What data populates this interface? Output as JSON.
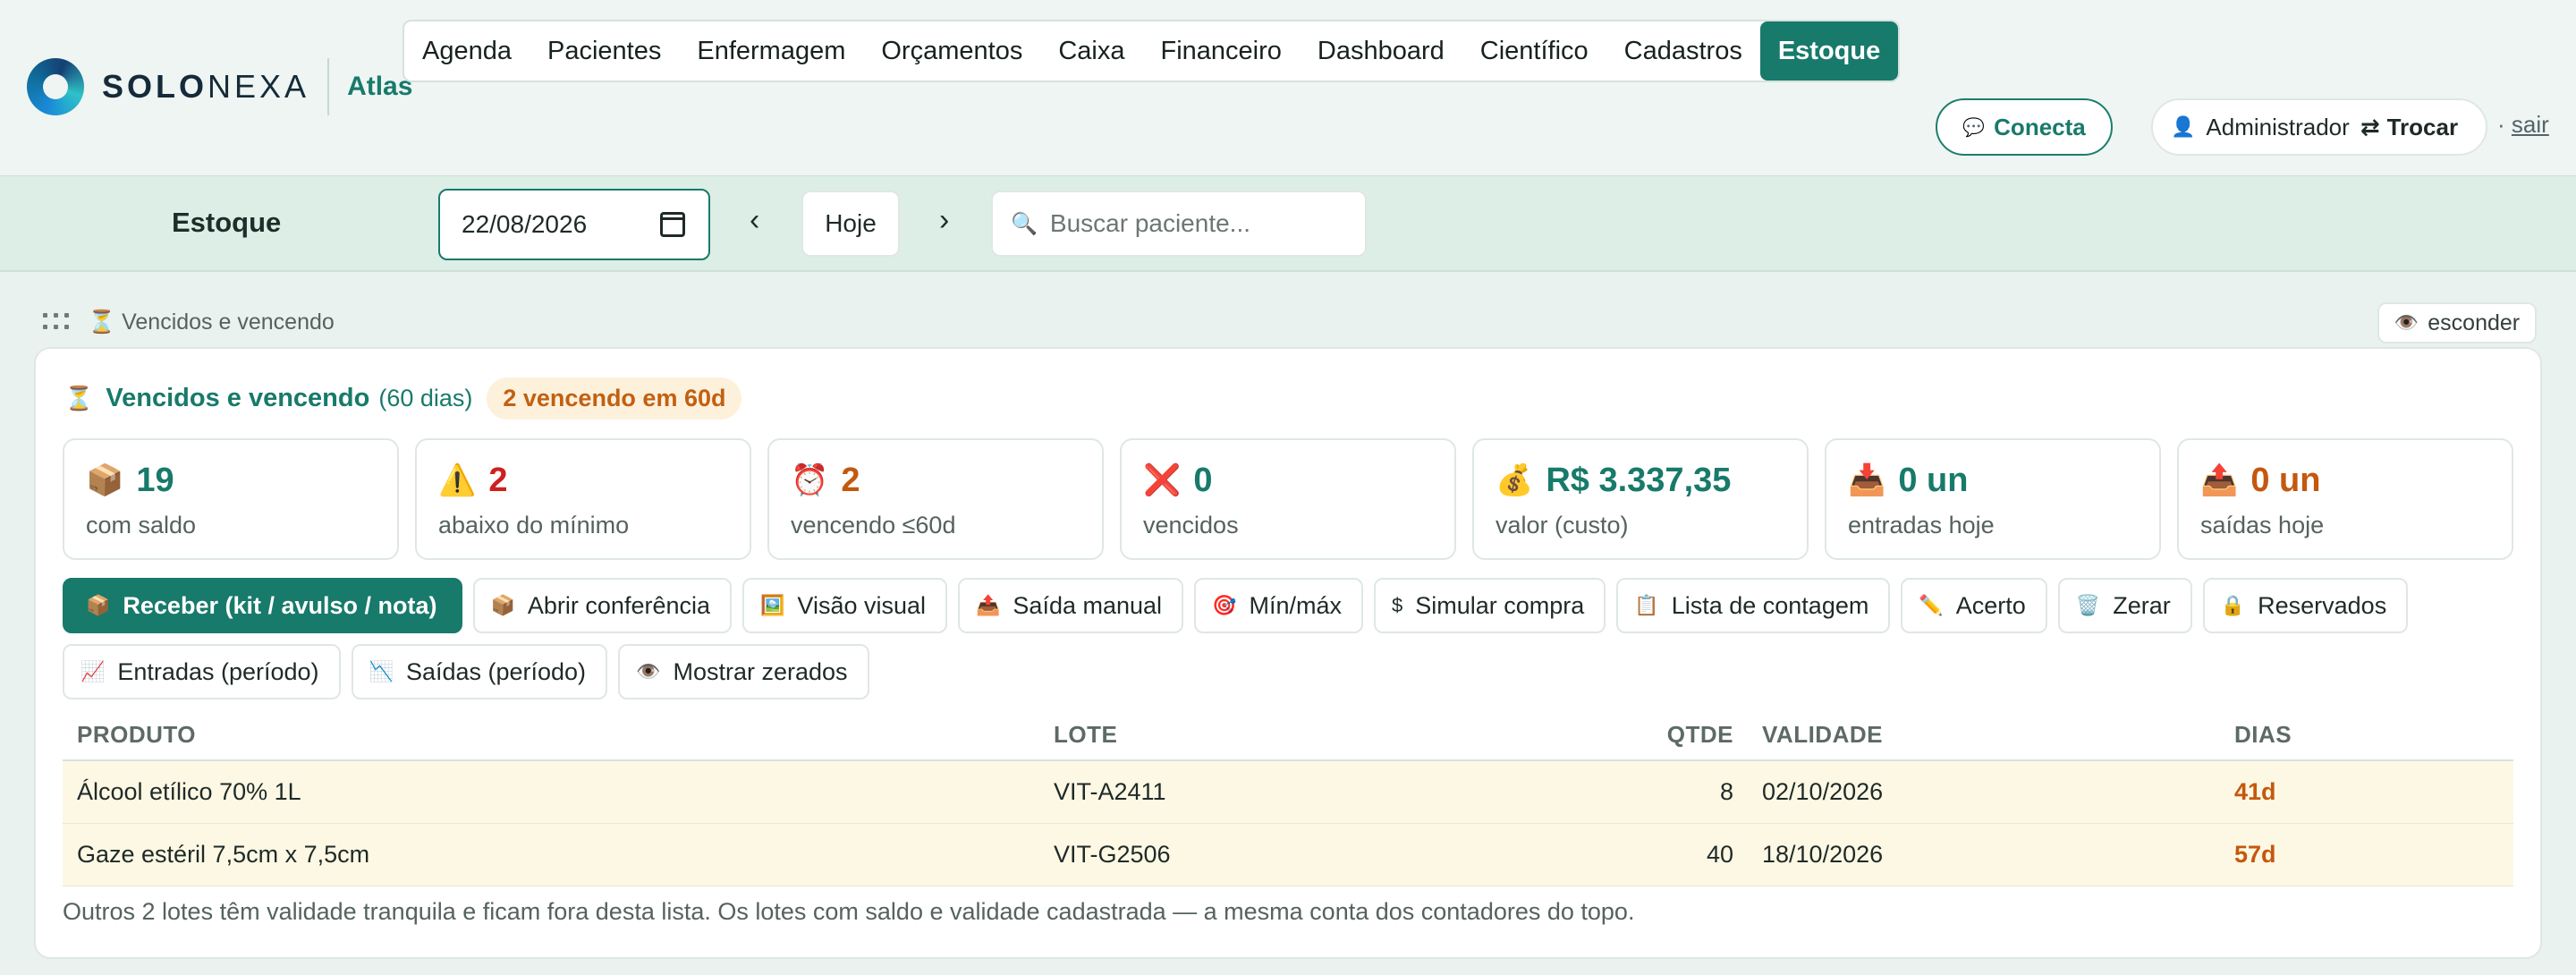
{
  "brand": {
    "name_bold": "SOLO",
    "name_light": "NEXA",
    "product": "Atlas"
  },
  "nav": {
    "items": [
      {
        "label": "Agenda"
      },
      {
        "label": "Pacientes"
      },
      {
        "label": "Enfermagem"
      },
      {
        "label": "Orçamentos"
      },
      {
        "label": "Caixa"
      },
      {
        "label": "Financeiro"
      },
      {
        "label": "Dashboard"
      },
      {
        "label": "Científico"
      },
      {
        "label": "Cadastros"
      },
      {
        "label": "Estoque"
      }
    ],
    "active": "Estoque"
  },
  "header": {
    "conecta_label": "Conecta",
    "user_label": "Administrador",
    "swap_glyph": "⇄",
    "switch_label": "Trocar",
    "logout_sep": "·",
    "logout_label": "sair"
  },
  "toolbar": {
    "page_title": "Estoque",
    "date_value": "22/08/2026",
    "prev_glyph": "‹",
    "next_glyph": "›",
    "today_label": "Hoje",
    "search_placeholder": "Buscar paciente..."
  },
  "widget": {
    "label": "Vencidos e vencendo",
    "hide_label": "esconder",
    "title": "Vencidos e vencendo",
    "range": "(60 dias)",
    "badge": "2 vencendo em 60d"
  },
  "cards": [
    {
      "icon": "📦",
      "icon_name": "box-icon",
      "value": "19",
      "label": "com saldo",
      "color": "#187a6a"
    },
    {
      "icon": "⚠️",
      "icon_name": "warning-icon",
      "value": "2",
      "label": "abaixo do mínimo",
      "color": "#cf1f1f"
    },
    {
      "icon": "⏰",
      "icon_name": "alarm-clock-icon",
      "value": "2",
      "label": "vencendo ≤60d",
      "color": "#c4580e"
    },
    {
      "icon": "❌",
      "icon_name": "cross-icon",
      "value": "0",
      "label": "vencidos",
      "color": "#187a6a"
    },
    {
      "icon": "💰",
      "icon_name": "money-bag-icon",
      "value": "R$ 3.337,35",
      "label": "valor (custo)",
      "color": "#187a6a"
    },
    {
      "icon": "📥",
      "icon_name": "inbox-icon",
      "value": "0 un",
      "label": "entradas hoje",
      "color": "#187a6a"
    },
    {
      "icon": "📤",
      "icon_name": "outbox-icon",
      "value": "0 un",
      "label": "saídas hoje",
      "color": "#c4580e"
    }
  ],
  "actions": [
    {
      "icon": "📦",
      "icon_name": "box-icon",
      "label": "Receber (kit / avulso / nota)",
      "primary": true
    },
    {
      "icon": "📦",
      "icon_name": "box-icon",
      "label": "Abrir conferência"
    },
    {
      "icon": "🖼️",
      "icon_name": "picture-icon",
      "label": "Visão visual"
    },
    {
      "icon": "📤",
      "icon_name": "outbox-icon",
      "label": "Saída manual"
    },
    {
      "icon": "🎯",
      "icon_name": "target-icon",
      "label": "Mín/máx"
    },
    {
      "icon": "$",
      "icon_name": "dollar-icon",
      "label": "Simular compra"
    },
    {
      "icon": "📋",
      "icon_name": "clipboard-icon",
      "label": "Lista de contagem"
    },
    {
      "icon": "✏️",
      "icon_name": "pencil-icon",
      "label": "Acerto"
    },
    {
      "icon": "🗑️",
      "icon_name": "trash-icon",
      "label": "Zerar"
    },
    {
      "icon": "🔒",
      "icon_name": "lock-icon",
      "label": "Reservados"
    },
    {
      "icon": "📈",
      "icon_name": "chart-up-icon",
      "label": "Entradas (período)"
    },
    {
      "icon": "📉",
      "icon_name": "chart-down-icon",
      "label": "Saídas (período)"
    },
    {
      "icon": "👁️",
      "icon_name": "eye-icon",
      "label": "Mostrar zerados"
    }
  ],
  "table": {
    "headers": [
      "PRODUTO",
      "LOTE",
      "QTDE",
      "VALIDADE",
      "DIAS"
    ],
    "rows": [
      {
        "produto": "Álcool etílico 70% 1L",
        "lote": "VIT-A2411",
        "qtde": "8",
        "validade": "02/10/2026",
        "dias": "41d"
      },
      {
        "produto": "Gaze estéril 7,5cm x 7,5cm",
        "lote": "VIT-G2506",
        "qtde": "40",
        "validade": "18/10/2026",
        "dias": "57d"
      }
    ]
  },
  "footnote": "Outros 2 lotes têm validade tranquila e ficam fora desta lista. Os lotes com saldo e validade cadastrada — a mesma conta dos contadores do topo.",
  "colors": {
    "accent": "#177a6b",
    "warning": "#c4580e",
    "danger": "#cf1f1f",
    "row_highlight": "#fdf8e4"
  }
}
